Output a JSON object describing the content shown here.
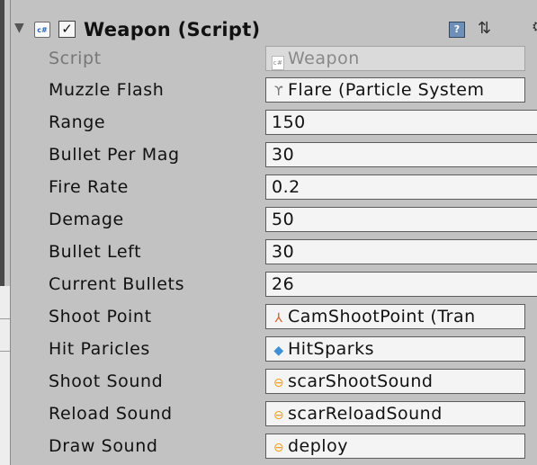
{
  "component": {
    "title": "Weapon (Script)",
    "enabled": true,
    "foldout_icon": "triangle-down-icon",
    "script_icon": "csharp-file-icon",
    "header_icons": [
      "help-book-icon",
      "preset-sliders-icon",
      "gear-icon"
    ]
  },
  "icons": {
    "foldout": "▼",
    "checkmark": "✓",
    "cs": "c#",
    "help": "?",
    "preset": "⇅",
    "gear": "⚙",
    "target": "⊙",
    "particle": "ϒ",
    "transform": "⅄",
    "prefab": "◆",
    "audio": "⊖",
    "script": "c#"
  },
  "fields": [
    {
      "label": "Script",
      "value": "Weapon",
      "kind": "object",
      "icon": "script-icon",
      "disabled": true
    },
    {
      "label": "Muzzle Flash",
      "value": "Flare (Particle System",
      "kind": "object",
      "icon": "particle-system-icon"
    },
    {
      "label": "Range",
      "value": "150",
      "kind": "number"
    },
    {
      "label": "Bullet Per Mag",
      "value": "30",
      "kind": "number"
    },
    {
      "label": "Fire Rate",
      "value": "0.2",
      "kind": "number"
    },
    {
      "label": "Demage",
      "value": "50",
      "kind": "number"
    },
    {
      "label": "Bullet Left",
      "value": "30",
      "kind": "number"
    },
    {
      "label": "Current Bullets",
      "value": "26",
      "kind": "number"
    },
    {
      "label": "Shoot Point",
      "value": "CamShootPoint (Tran",
      "kind": "object",
      "icon": "transform-icon"
    },
    {
      "label": "Hit Paricles",
      "value": "HitSparks",
      "kind": "object",
      "icon": "prefab-icon"
    },
    {
      "label": "Shoot Sound",
      "value": "scarShootSound",
      "kind": "object",
      "icon": "audio-clip-icon"
    },
    {
      "label": "Reload Sound",
      "value": "scarReloadSound",
      "kind": "object",
      "icon": "audio-clip-icon"
    },
    {
      "label": "Draw Sound",
      "value": "deploy",
      "kind": "object",
      "icon": "audio-clip-icon"
    }
  ],
  "colors": {
    "panel_bg": "#c2c2c2",
    "field_bg": "#f4f4f4",
    "field_border": "#5c5c5c",
    "disabled_text": "#777777",
    "particle_icon": "#777777",
    "transform_icon": "#e05a2a",
    "prefab_icon": "#3d8fd6",
    "audio_icon": "#f0a020"
  }
}
